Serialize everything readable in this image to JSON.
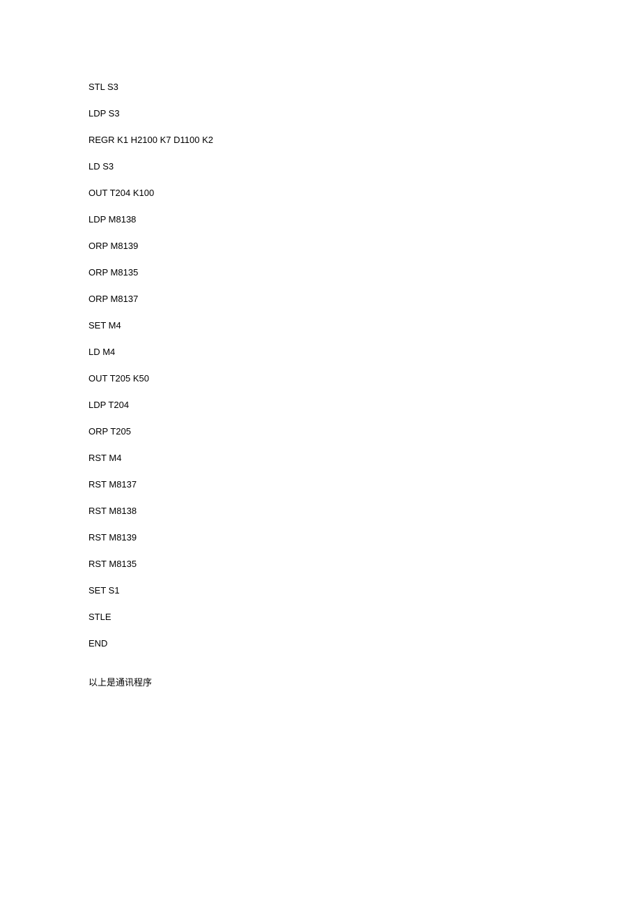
{
  "code": {
    "lines": [
      "STL S3",
      "LDP S3",
      "REGR K1 H2100 K7 D1100 K2",
      "LD S3",
      "OUT T204 K100",
      "LDP M8138",
      "ORP M8139",
      "ORP M8135",
      "ORP M8137",
      "SET M4",
      "LD M4",
      "OUT T205 K50",
      "LDP T204",
      "ORP T205",
      "RST M4",
      "RST M8137",
      "RST M8138",
      "RST M8139",
      "RST M8135",
      "SET S1",
      "STLE",
      "END"
    ]
  },
  "footer": "以上是通讯程序"
}
